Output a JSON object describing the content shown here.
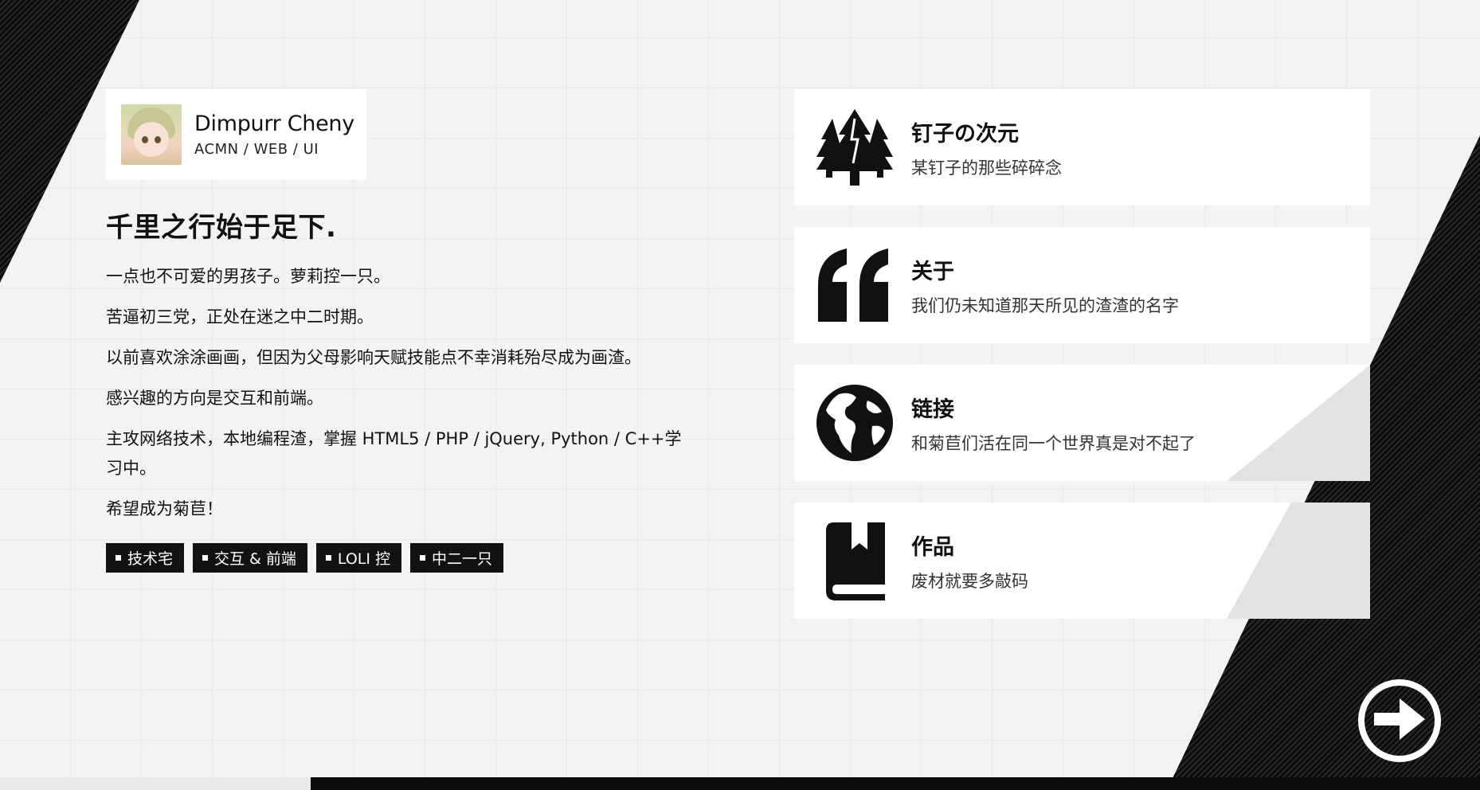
{
  "profile": {
    "name": "Dimpurr Cheny",
    "roles": "ACMN / WEB / UI"
  },
  "intro": {
    "headline": "千里之行始于足下.",
    "paragraphs": [
      "一点也不可爱的男孩子。萝莉控一只。",
      "苦逼初三党，正处在迷之中二时期。",
      "以前喜欢涂涂画画，但因为父母影响天赋技能点不幸消耗殆尽成为画渣。",
      "感兴趣的方向是交互和前端。",
      "主攻网络技术，本地编程渣，掌握 HTML5 / PHP / jQuery, Python / C++学习中。",
      "希望成为菊苣！"
    ],
    "tags": [
      "技术宅",
      "交互 & 前端",
      "LOLI 控",
      "中二一只"
    ]
  },
  "cards": [
    {
      "icon": "trees-icon",
      "title": "钉子の次元",
      "subtitle": "某钉子的那些碎碎念"
    },
    {
      "icon": "quote-icon",
      "title": "关于",
      "subtitle": "我们仍未知道那天所见的渣渣的名字"
    },
    {
      "icon": "globe-icon",
      "title": "链接",
      "subtitle": "和菊苣们活在同一个世界真是对不起了"
    },
    {
      "icon": "book-icon",
      "title": "作品",
      "subtitle": "废材就要多敲码"
    }
  ],
  "next_button": {
    "icon": "arrow-right-circle-icon"
  },
  "colors": {
    "dark": "#111111",
    "light": "#f3f3f3",
    "card": "#ffffff"
  }
}
